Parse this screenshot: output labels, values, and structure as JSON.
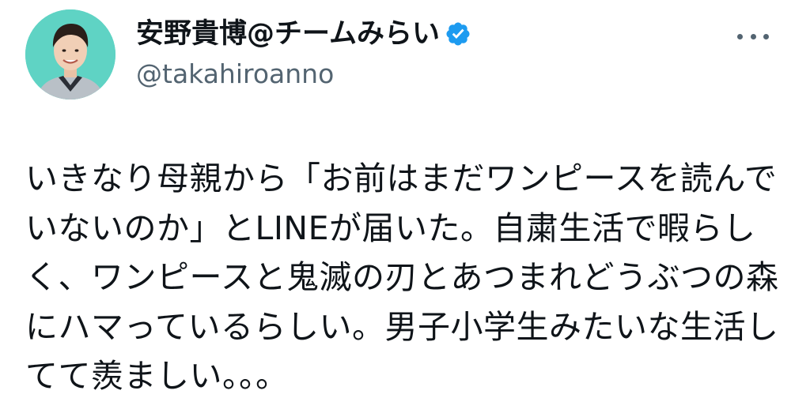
{
  "author": {
    "display_name": "安野貴博@チームみらい",
    "handle": "@takahiroanno",
    "verified_icon": "verified-badge-icon",
    "colors": {
      "verified_badge": "#1d9bf0",
      "avatar_background": "#5fd3c4"
    }
  },
  "menu": {
    "icon": "more-horizontal-icon"
  },
  "tweet": {
    "lines": [
      "いきなり母親から「お前はまだワンピースを読んで",
      "いないのか」とLINEが届いた。自粛生活で暇らし",
      "く、ワンピースと鬼滅の刃とあつまれどうぶつの森",
      "にハマっているらしい。男子小学生みたいな生活し",
      "てて羨ましい。。。"
    ]
  }
}
